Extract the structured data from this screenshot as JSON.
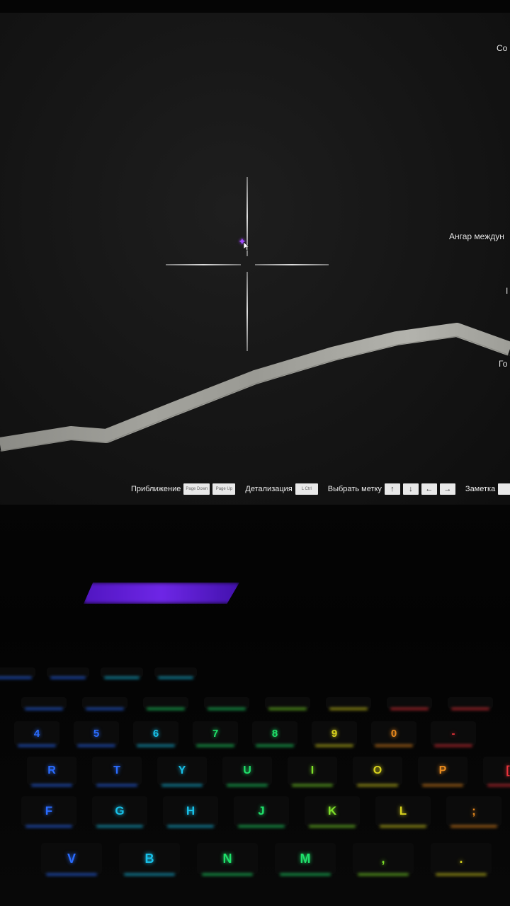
{
  "map": {
    "labels": {
      "top_right": "Co",
      "hangar": "Ангар междун",
      "mid_right": "I",
      "lower_right": "Го"
    }
  },
  "hint_bar": {
    "zoom_label": "Приближение",
    "zoom_key_in": "Page Down",
    "zoom_key_out": "Page Up",
    "detail_label": "Детализация",
    "detail_key": "L Ctrl",
    "select_label": "Выбрать метку",
    "note_label": "Заметка"
  },
  "icons": {
    "up": "arrow-up-icon",
    "down": "arrow-down-icon",
    "left": "arrow-left-icon",
    "right": "arrow-right-icon"
  },
  "keyboard": {
    "row_fn": [
      "",
      "",
      "",
      ""
    ],
    "row_media": [
      "",
      "",
      "",
      "",
      "",
      "",
      "",
      ""
    ],
    "row_numbers": [
      "4",
      "5",
      "6",
      "7",
      "8",
      "9",
      "0",
      "-"
    ],
    "row_top": [
      "R",
      "T",
      "Y",
      "U",
      "I",
      "O",
      "P",
      "["
    ],
    "row_home": [
      "F",
      "G",
      "H",
      "J",
      "K",
      "L",
      ";"
    ],
    "row_bottom": [
      "V",
      "B",
      "N",
      "M",
      ",",
      "."
    ],
    "colors": {
      "blue": "#2a6cff",
      "cyan": "#18c0e8",
      "green": "#1fe06a",
      "lime": "#7ee02a",
      "yellow": "#d8d21e",
      "orange": "#e88a1e",
      "red": "#e8323a"
    }
  }
}
